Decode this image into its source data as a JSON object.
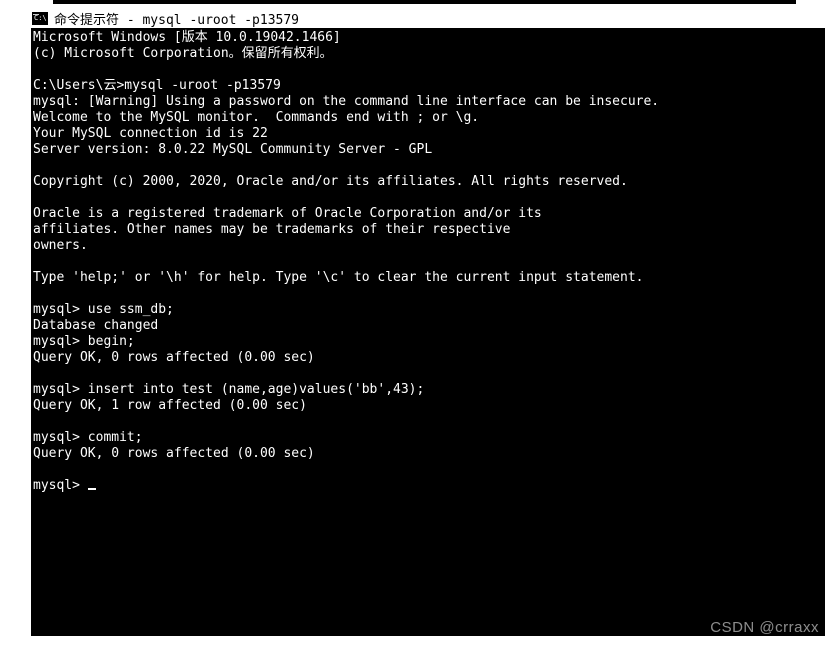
{
  "title_bar": {
    "icon_text": "C:\\",
    "title": "命令提示符 - mysql  -uroot -p13579"
  },
  "terminal": {
    "lines": [
      "Microsoft Windows [版本 10.0.19042.1466]",
      "(c) Microsoft Corporation。保留所有权利。",
      "",
      "C:\\Users\\云>mysql -uroot -p13579",
      "mysql: [Warning] Using a password on the command line interface can be insecure.",
      "Welcome to the MySQL monitor.  Commands end with ; or \\g.",
      "Your MySQL connection id is 22",
      "Server version: 8.0.22 MySQL Community Server - GPL",
      "",
      "Copyright (c) 2000, 2020, Oracle and/or its affiliates. All rights reserved.",
      "",
      "Oracle is a registered trademark of Oracle Corporation and/or its",
      "affiliates. Other names may be trademarks of their respective",
      "owners.",
      "",
      "Type 'help;' or '\\h' for help. Type '\\c' to clear the current input statement.",
      "",
      "mysql> use ssm_db;",
      "Database changed",
      "mysql> begin;",
      "Query OK, 0 rows affected (0.00 sec)",
      "",
      "mysql> insert into test (name,age)values('bb',43);",
      "Query OK, 1 row affected (0.00 sec)",
      "",
      "mysql> commit;",
      "Query OK, 0 rows affected (0.00 sec)",
      "",
      "mysql> "
    ]
  },
  "watermark": "CSDN @crraxx"
}
